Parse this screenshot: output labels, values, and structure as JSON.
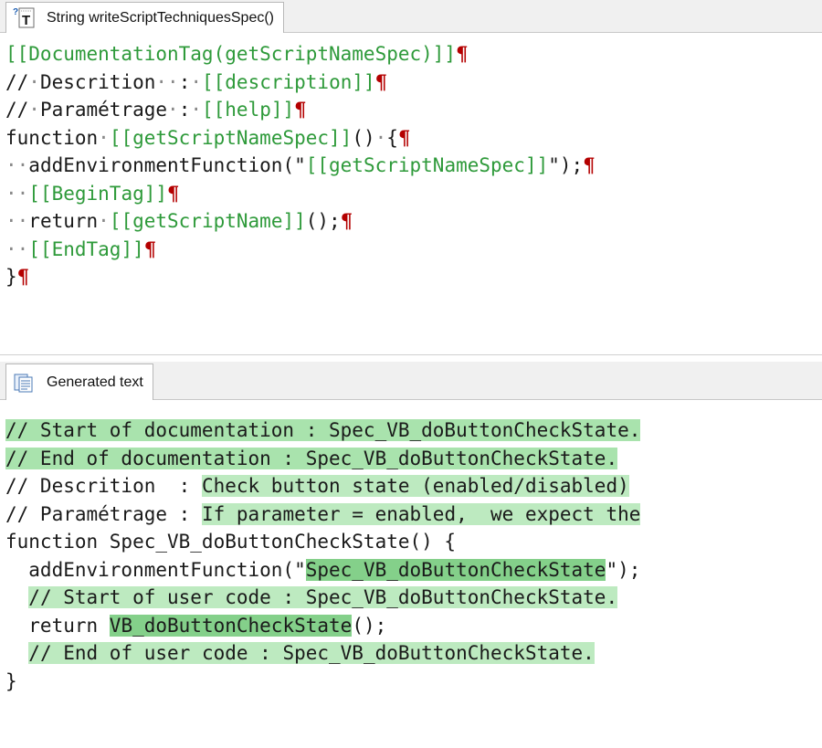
{
  "top_panel": {
    "tab_label": "String writeScriptTechniquesSpec()",
    "tab_icon": "help-text-icon",
    "code_lines": [
      [
        {
          "t": "[[DocumentationTag(getScriptNameSpec)]]",
          "c": "g"
        },
        {
          "t": "¶",
          "c": "pil"
        }
      ],
      [
        {
          "t": "//"
        },
        {
          "t": "·",
          "c": "ws"
        },
        {
          "t": "Descrition"
        },
        {
          "t": "··",
          "c": "ws"
        },
        {
          "t": ":"
        },
        {
          "t": "·",
          "c": "ws"
        },
        {
          "t": "[[description]]",
          "c": "g"
        },
        {
          "t": "¶",
          "c": "pil"
        }
      ],
      [
        {
          "t": "//"
        },
        {
          "t": "·",
          "c": "ws"
        },
        {
          "t": "Paramétrage"
        },
        {
          "t": "·",
          "c": "ws"
        },
        {
          "t": ":"
        },
        {
          "t": "·",
          "c": "ws"
        },
        {
          "t": "[[help]]",
          "c": "g"
        },
        {
          "t": "¶",
          "c": "pil"
        }
      ],
      [
        {
          "t": "function"
        },
        {
          "t": "·",
          "c": "ws"
        },
        {
          "t": "[[getScriptNameSpec]]",
          "c": "g"
        },
        {
          "t": "()"
        },
        {
          "t": "·",
          "c": "ws"
        },
        {
          "t": "{"
        },
        {
          "t": "¶",
          "c": "pil"
        }
      ],
      [
        {
          "t": "··",
          "c": "ws"
        },
        {
          "t": "addEnvironmentFunction(\""
        },
        {
          "t": "[[getScriptNameSpec]]",
          "c": "g"
        },
        {
          "t": "\");"
        },
        {
          "t": "¶",
          "c": "pil"
        }
      ],
      [
        {
          "t": "··",
          "c": "ws"
        },
        {
          "t": "[[BeginTag]]",
          "c": "g"
        },
        {
          "t": "¶",
          "c": "pil"
        }
      ],
      [
        {
          "t": "··",
          "c": "ws"
        },
        {
          "t": "return"
        },
        {
          "t": "·",
          "c": "ws"
        },
        {
          "t": "[[getScriptName]]",
          "c": "g"
        },
        {
          "t": "();"
        },
        {
          "t": "¶",
          "c": "pil"
        }
      ],
      [
        {
          "t": "··",
          "c": "ws"
        },
        {
          "t": "[[EndTag]]",
          "c": "g"
        },
        {
          "t": "¶",
          "c": "pil"
        }
      ],
      [
        {
          "t": "}"
        },
        {
          "t": "¶",
          "c": "pil"
        }
      ]
    ]
  },
  "bottom_panel": {
    "tab_label": "Generated text",
    "tab_icon": "document-text-icon",
    "code_lines": [
      [
        {
          "t": "// Start of documentation : Spec_VB_doButtonCheckState.",
          "c": "hl"
        }
      ],
      [
        {
          "t": "// End of documentation : Spec_VB_doButtonCheckState.",
          "c": "hl"
        }
      ],
      [
        {
          "t": "// Descrition  : "
        },
        {
          "t": "Check button state (enabled/disabled)",
          "c": "hl2"
        }
      ],
      [
        {
          "t": "// Paramétrage : "
        },
        {
          "t": "If parameter = enabled,  we expect the",
          "c": "hl2"
        }
      ],
      [
        {
          "t": "function Spec_VB_doButtonCheckState() {"
        }
      ],
      [
        {
          "t": "  addEnvironmentFunction(\""
        },
        {
          "t": "Spec_VB_doButtonCheckState",
          "c": "hl3"
        },
        {
          "t": "\");"
        }
      ],
      [
        {
          "t": "  "
        },
        {
          "t": "// Start of user code : Spec_VB_doButtonCheckState.",
          "c": "hl2"
        }
      ],
      [
        {
          "t": "  return "
        },
        {
          "t": "VB_doButtonCheckState",
          "c": "hl3"
        },
        {
          "t": "();"
        }
      ],
      [
        {
          "t": "  "
        },
        {
          "t": "// End of user code : Spec_VB_doButtonCheckState.",
          "c": "hl2"
        }
      ],
      [
        {
          "t": "}"
        }
      ]
    ]
  }
}
